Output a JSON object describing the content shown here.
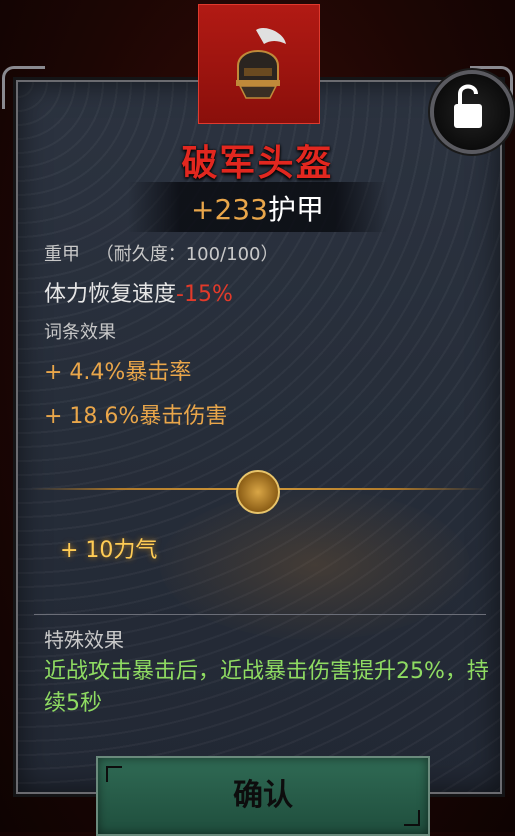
{
  "item": {
    "name": "破军头盔",
    "armor_value": "+233",
    "armor_label": "护甲",
    "armor_type": "重甲",
    "durability_label": "（耐久度：",
    "durability_value": "100/100",
    "durability_close": "）",
    "stamina_label": "体力恢复速度",
    "stamina_value": "-15%"
  },
  "affixes": {
    "title": "词条效果",
    "items": [
      "+ 4.4%暴击率",
      "+ 18.6%暴击伤害"
    ]
  },
  "bonus": "+ 10力气",
  "special": {
    "title": "特殊效果",
    "text": "近战攻击暴击后，近战暴击伤害提升25%，持续5秒"
  },
  "buttons": {
    "confirm": "确认"
  },
  "icons": {
    "item": "helmet-icon",
    "lock": "unlock-icon",
    "medallion": "yin-yang-icon"
  },
  "colors": {
    "name": "#e2271f",
    "value_gold": "#e9a64a",
    "special_green": "#8fdc62",
    "tile_red": "#b21a14",
    "button_green": "#2f6a54"
  }
}
